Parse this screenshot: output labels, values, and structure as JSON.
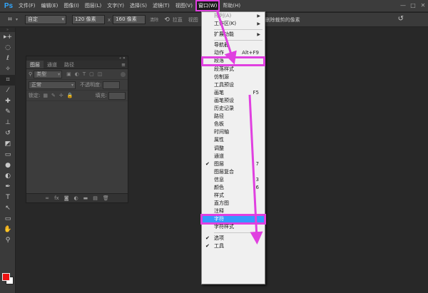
{
  "app": {
    "logo": "Ps"
  },
  "menubar": {
    "items": [
      "文件(F)",
      "编辑(E)",
      "图像(I)",
      "图层(L)",
      "文字(Y)",
      "选择(S)",
      "滤镜(T)",
      "视图(V)",
      "窗口(W)",
      "帮助(H)"
    ],
    "active_index": 8
  },
  "window_controls": [
    "—",
    "□",
    "✕"
  ],
  "options_bar": {
    "crop_icon": "crop-icon",
    "ratio_select": "自定",
    "width_value": "120 像素",
    "swap_symbol": "x",
    "height_value": "160 像素",
    "clear_label": "清除",
    "straighten_label": "拉直",
    "view_label": "视图",
    "delete_cropped_label": "删除裁剪的像素",
    "reset_icon": "reset-icon"
  },
  "tools": [
    {
      "name": "move-tool-icon",
      "glyph": "▸+"
    },
    {
      "name": "marquee-tool-icon",
      "glyph": "◌"
    },
    {
      "name": "lasso-tool-icon",
      "glyph": "ℓ"
    },
    {
      "name": "quick-select-tool-icon",
      "glyph": "✧"
    },
    {
      "name": "crop-tool-icon",
      "glyph": "⌗"
    },
    {
      "name": "eyedropper-tool-icon",
      "glyph": "⁄"
    },
    {
      "name": "healing-brush-tool-icon",
      "glyph": "✚"
    },
    {
      "name": "brush-tool-icon",
      "glyph": "✎"
    },
    {
      "name": "clone-stamp-tool-icon",
      "glyph": "⊥"
    },
    {
      "name": "history-brush-tool-icon",
      "glyph": "↺"
    },
    {
      "name": "eraser-tool-icon",
      "glyph": "◩"
    },
    {
      "name": "gradient-tool-icon",
      "glyph": "▭"
    },
    {
      "name": "blur-tool-icon",
      "glyph": "●"
    },
    {
      "name": "dodge-tool-icon",
      "glyph": "◐"
    },
    {
      "name": "pen-tool-icon",
      "glyph": "✒"
    },
    {
      "name": "type-tool-icon",
      "glyph": "T"
    },
    {
      "name": "path-selection-tool-icon",
      "glyph": "↖"
    },
    {
      "name": "shape-tool-icon",
      "glyph": "▭"
    },
    {
      "name": "hand-tool-icon",
      "glyph": "✋"
    },
    {
      "name": "zoom-tool-icon",
      "glyph": "⚲"
    }
  ],
  "colors": {
    "foreground": "#ee1111",
    "background": "#ffffff",
    "annotation": "#e040e0",
    "highlight": "#3399ff"
  },
  "layers_panel": {
    "tabs": [
      "图层",
      "通道",
      "路径"
    ],
    "active_tab": 0,
    "filter_label": "类型",
    "blend_mode": "正常",
    "opacity_label": "不透明度:",
    "lock_label": "锁定:",
    "fill_label": "填充:"
  },
  "window_menu": {
    "items": [
      {
        "label": "排列(A)",
        "disabled": true,
        "submenu": true
      },
      {
        "label": "工作区(K)",
        "submenu": true
      },
      {
        "sep": true
      },
      {
        "label": "扩展功能",
        "submenu": true
      },
      {
        "sep": true
      },
      {
        "label": "导航器"
      },
      {
        "label": "动作",
        "shortcut": "Alt+F9"
      },
      {
        "label": "段落",
        "boxed": true
      },
      {
        "label": "段落样式"
      },
      {
        "label": "仿制源"
      },
      {
        "label": "工具预设"
      },
      {
        "label": "画笔",
        "shortcut": "F5"
      },
      {
        "label": "画笔预设"
      },
      {
        "label": "历史记录"
      },
      {
        "label": "路径"
      },
      {
        "label": "色板"
      },
      {
        "label": "时间轴"
      },
      {
        "label": "属性"
      },
      {
        "label": "调整"
      },
      {
        "label": "通道"
      },
      {
        "label": "图层",
        "checked": true,
        "shortcut": "7"
      },
      {
        "label": "图层复合"
      },
      {
        "label": "信息",
        "shortcut": "3"
      },
      {
        "label": "颜色",
        "shortcut": "6"
      },
      {
        "label": "样式"
      },
      {
        "label": "直方图"
      },
      {
        "label": "注释"
      },
      {
        "label": "字符",
        "highlight": true
      },
      {
        "label": "字符样式"
      },
      {
        "sep": true
      },
      {
        "label": "选项",
        "checked": true
      },
      {
        "label": "工具",
        "checked": true
      }
    ]
  }
}
